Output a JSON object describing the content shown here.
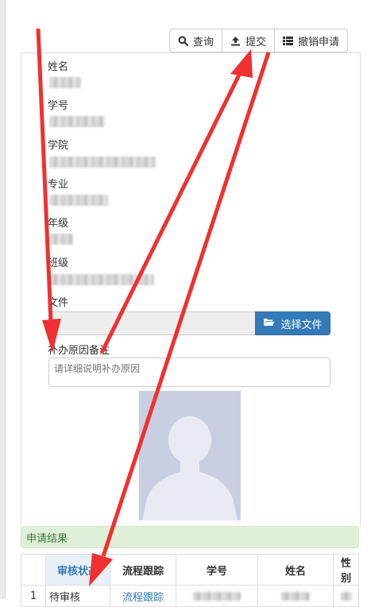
{
  "toolbar": {
    "query_label": "查询",
    "submit_label": "提交",
    "cancel_label": "撤销申请"
  },
  "form": {
    "name_label": "姓名",
    "student_id_label": "学号",
    "college_label": "学院",
    "major_label": "专业",
    "grade_label": "年级",
    "class_label": "班级",
    "file_label": "文件",
    "file_button_label": "选择文件",
    "remark_label": "补办原因备注",
    "remark_placeholder": "请详细说明补办原因"
  },
  "result": {
    "title": "申请结果",
    "columns": [
      "",
      "审核状态",
      "流程跟踪",
      "学号",
      "姓名",
      "性别"
    ],
    "rows": [
      {
        "index": "1",
        "status": "待审核",
        "trace": "流程跟踪"
      }
    ]
  },
  "colors": {
    "primary": "#337ab7",
    "success_bg": "#dff0d8",
    "annotation_arrow": "#f03030"
  }
}
